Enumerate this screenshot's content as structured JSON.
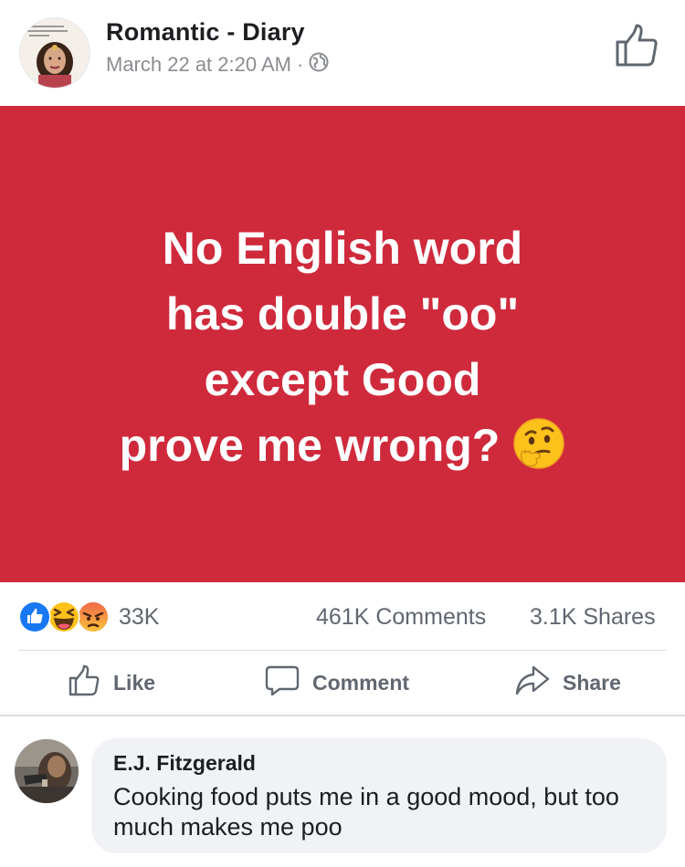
{
  "post": {
    "page_name": "Romantic - Diary",
    "timestamp": "March 22 at 2:20 AM",
    "separator": "·",
    "privacy_icon": "globe-icon",
    "text_lines": [
      "No English word",
      "has double \"oo\"",
      "except Good",
      "prove me wrong?"
    ],
    "emoji": "thinking-face",
    "background_color": "#cf2a3c"
  },
  "stats": {
    "reactions": [
      "like",
      "haha",
      "angry"
    ],
    "reaction_count": "33K",
    "comments": "461K Comments",
    "shares": "3.1K Shares"
  },
  "actions": {
    "like": "Like",
    "comment": "Comment",
    "share": "Share"
  },
  "comment": {
    "author": "E.J. Fitzgerald",
    "text": "Cooking food puts me in a good mood, but too much makes me poo"
  }
}
